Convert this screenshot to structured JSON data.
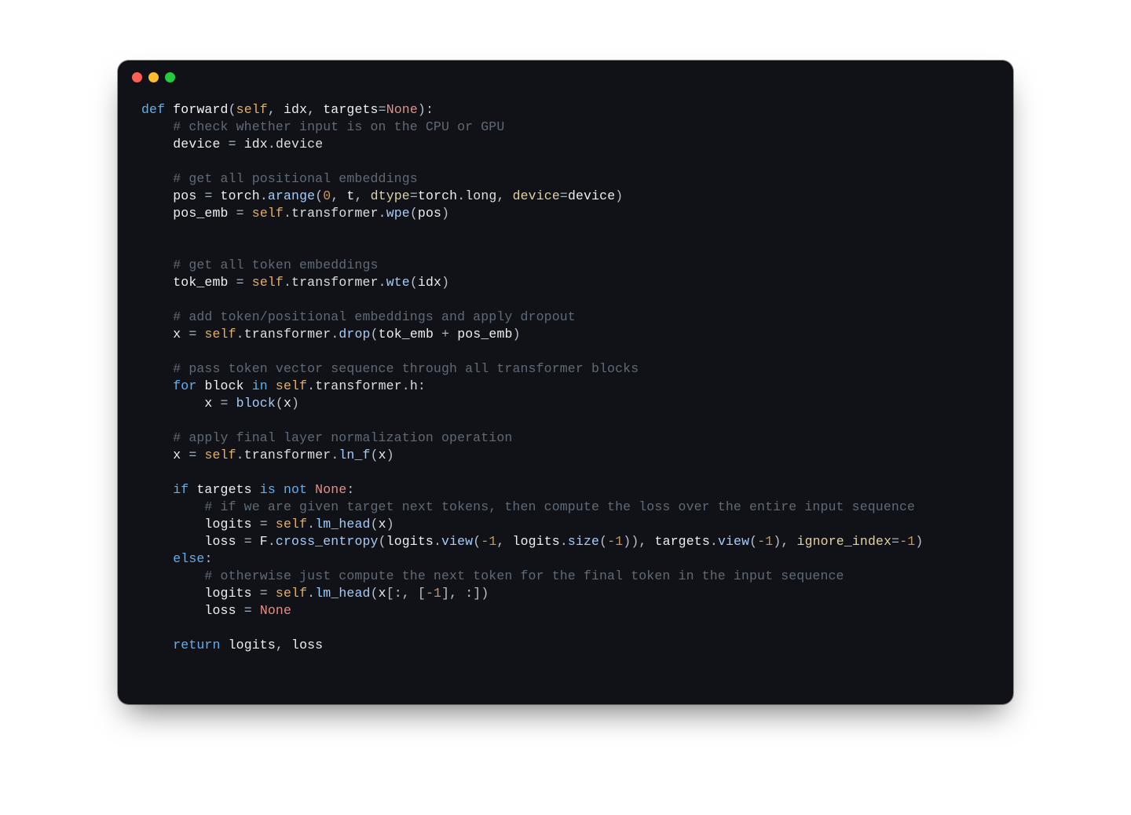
{
  "window": {
    "title": ""
  },
  "colors": {
    "editor_bg": "#111217",
    "dot_red": "#ff5f56",
    "dot_yellow": "#ffbd2e",
    "dot_green": "#27c93f"
  },
  "code": {
    "lines": [
      [
        {
          "t": "kw",
          "v": "def "
        },
        {
          "t": "fn",
          "v": "forward"
        },
        {
          "t": "punct",
          "v": "("
        },
        {
          "t": "self",
          "v": "self"
        },
        {
          "t": "punct",
          "v": ", "
        },
        {
          "t": "var",
          "v": "idx"
        },
        {
          "t": "punct",
          "v": ", "
        },
        {
          "t": "var",
          "v": "targets"
        },
        {
          "t": "op",
          "v": "="
        },
        {
          "t": "none",
          "v": "None"
        },
        {
          "t": "punct",
          "v": "):"
        }
      ],
      [
        {
          "t": "indent",
          "v": "    "
        },
        {
          "t": "comment",
          "v": "# check whether input is on the CPU or GPU"
        }
      ],
      [
        {
          "t": "indent",
          "v": "    "
        },
        {
          "t": "var",
          "v": "device "
        },
        {
          "t": "op",
          "v": "="
        },
        {
          "t": "var",
          "v": " idx"
        },
        {
          "t": "punct",
          "v": "."
        },
        {
          "t": "prop",
          "v": "device"
        }
      ],
      [],
      [
        {
          "t": "indent",
          "v": "    "
        },
        {
          "t": "comment",
          "v": "# get all positional embeddings"
        }
      ],
      [
        {
          "t": "indent",
          "v": "    "
        },
        {
          "t": "var",
          "v": "pos "
        },
        {
          "t": "op",
          "v": "="
        },
        {
          "t": "var",
          "v": " torch"
        },
        {
          "t": "punct",
          "v": "."
        },
        {
          "t": "method",
          "v": "arange"
        },
        {
          "t": "punct",
          "v": "("
        },
        {
          "t": "num",
          "v": "0"
        },
        {
          "t": "punct",
          "v": ", "
        },
        {
          "t": "var",
          "v": "t"
        },
        {
          "t": "punct",
          "v": ", "
        },
        {
          "t": "kwarg",
          "v": "dtype"
        },
        {
          "t": "op",
          "v": "="
        },
        {
          "t": "var",
          "v": "torch"
        },
        {
          "t": "punct",
          "v": "."
        },
        {
          "t": "prop",
          "v": "long"
        },
        {
          "t": "punct",
          "v": ", "
        },
        {
          "t": "kwarg",
          "v": "device"
        },
        {
          "t": "op",
          "v": "="
        },
        {
          "t": "var",
          "v": "device"
        },
        {
          "t": "punct",
          "v": ")"
        }
      ],
      [
        {
          "t": "indent",
          "v": "    "
        },
        {
          "t": "var",
          "v": "pos_emb "
        },
        {
          "t": "op",
          "v": "="
        },
        {
          "t": "var",
          "v": " "
        },
        {
          "t": "self",
          "v": "self"
        },
        {
          "t": "punct",
          "v": "."
        },
        {
          "t": "prop",
          "v": "transformer"
        },
        {
          "t": "punct",
          "v": "."
        },
        {
          "t": "method",
          "v": "wpe"
        },
        {
          "t": "punct",
          "v": "("
        },
        {
          "t": "var",
          "v": "pos"
        },
        {
          "t": "punct",
          "v": ")"
        }
      ],
      [],
      [],
      [
        {
          "t": "indent",
          "v": "    "
        },
        {
          "t": "comment",
          "v": "# get all token embeddings"
        }
      ],
      [
        {
          "t": "indent",
          "v": "    "
        },
        {
          "t": "var",
          "v": "tok_emb "
        },
        {
          "t": "op",
          "v": "="
        },
        {
          "t": "var",
          "v": " "
        },
        {
          "t": "self",
          "v": "self"
        },
        {
          "t": "punct",
          "v": "."
        },
        {
          "t": "prop",
          "v": "transformer"
        },
        {
          "t": "punct",
          "v": "."
        },
        {
          "t": "method",
          "v": "wte"
        },
        {
          "t": "punct",
          "v": "("
        },
        {
          "t": "var",
          "v": "idx"
        },
        {
          "t": "punct",
          "v": ")"
        }
      ],
      [],
      [
        {
          "t": "indent",
          "v": "    "
        },
        {
          "t": "comment",
          "v": "# add token/positional embeddings and apply dropout"
        }
      ],
      [
        {
          "t": "indent",
          "v": "    "
        },
        {
          "t": "var",
          "v": "x "
        },
        {
          "t": "op",
          "v": "="
        },
        {
          "t": "var",
          "v": " "
        },
        {
          "t": "self",
          "v": "self"
        },
        {
          "t": "punct",
          "v": "."
        },
        {
          "t": "prop",
          "v": "transformer"
        },
        {
          "t": "punct",
          "v": "."
        },
        {
          "t": "method",
          "v": "drop"
        },
        {
          "t": "punct",
          "v": "("
        },
        {
          "t": "var",
          "v": "tok_emb "
        },
        {
          "t": "op",
          "v": "+"
        },
        {
          "t": "var",
          "v": " pos_emb"
        },
        {
          "t": "punct",
          "v": ")"
        }
      ],
      [],
      [
        {
          "t": "indent",
          "v": "    "
        },
        {
          "t": "comment",
          "v": "# pass token vector sequence through all transformer blocks"
        }
      ],
      [
        {
          "t": "indent",
          "v": "    "
        },
        {
          "t": "kw",
          "v": "for "
        },
        {
          "t": "var",
          "v": "block "
        },
        {
          "t": "kw",
          "v": "in "
        },
        {
          "t": "self",
          "v": "self"
        },
        {
          "t": "punct",
          "v": "."
        },
        {
          "t": "prop",
          "v": "transformer"
        },
        {
          "t": "punct",
          "v": "."
        },
        {
          "t": "prop",
          "v": "h"
        },
        {
          "t": "punct",
          "v": ":"
        }
      ],
      [
        {
          "t": "indent",
          "v": "        "
        },
        {
          "t": "var",
          "v": "x "
        },
        {
          "t": "op",
          "v": "="
        },
        {
          "t": "var",
          "v": " "
        },
        {
          "t": "method",
          "v": "block"
        },
        {
          "t": "punct",
          "v": "("
        },
        {
          "t": "var",
          "v": "x"
        },
        {
          "t": "punct",
          "v": ")"
        }
      ],
      [],
      [
        {
          "t": "indent",
          "v": "    "
        },
        {
          "t": "comment",
          "v": "# apply final layer normalization operation"
        }
      ],
      [
        {
          "t": "indent",
          "v": "    "
        },
        {
          "t": "var",
          "v": "x "
        },
        {
          "t": "op",
          "v": "="
        },
        {
          "t": "var",
          "v": " "
        },
        {
          "t": "self",
          "v": "self"
        },
        {
          "t": "punct",
          "v": "."
        },
        {
          "t": "prop",
          "v": "transformer"
        },
        {
          "t": "punct",
          "v": "."
        },
        {
          "t": "method",
          "v": "ln_f"
        },
        {
          "t": "punct",
          "v": "("
        },
        {
          "t": "var",
          "v": "x"
        },
        {
          "t": "punct",
          "v": ")"
        }
      ],
      [],
      [
        {
          "t": "indent",
          "v": "    "
        },
        {
          "t": "kw",
          "v": "if "
        },
        {
          "t": "var",
          "v": "targets "
        },
        {
          "t": "kw",
          "v": "is not "
        },
        {
          "t": "none",
          "v": "None"
        },
        {
          "t": "punct",
          "v": ":"
        }
      ],
      [
        {
          "t": "indent",
          "v": "        "
        },
        {
          "t": "comment",
          "v": "# if we are given target next tokens, then compute the loss over the entire input sequence"
        }
      ],
      [
        {
          "t": "indent",
          "v": "        "
        },
        {
          "t": "var",
          "v": "logits "
        },
        {
          "t": "op",
          "v": "="
        },
        {
          "t": "var",
          "v": " "
        },
        {
          "t": "self",
          "v": "self"
        },
        {
          "t": "punct",
          "v": "."
        },
        {
          "t": "method",
          "v": "lm_head"
        },
        {
          "t": "punct",
          "v": "("
        },
        {
          "t": "var",
          "v": "x"
        },
        {
          "t": "punct",
          "v": ")"
        }
      ],
      [
        {
          "t": "indent",
          "v": "        "
        },
        {
          "t": "var",
          "v": "loss "
        },
        {
          "t": "op",
          "v": "="
        },
        {
          "t": "var",
          "v": " F"
        },
        {
          "t": "punct",
          "v": "."
        },
        {
          "t": "method",
          "v": "cross_entropy"
        },
        {
          "t": "punct",
          "v": "("
        },
        {
          "t": "var",
          "v": "logits"
        },
        {
          "t": "punct",
          "v": "."
        },
        {
          "t": "method",
          "v": "view"
        },
        {
          "t": "punct",
          "v": "("
        },
        {
          "t": "num",
          "v": "-1"
        },
        {
          "t": "punct",
          "v": ", "
        },
        {
          "t": "var",
          "v": "logits"
        },
        {
          "t": "punct",
          "v": "."
        },
        {
          "t": "method",
          "v": "size"
        },
        {
          "t": "punct",
          "v": "("
        },
        {
          "t": "num",
          "v": "-1"
        },
        {
          "t": "punct",
          "v": "))"
        },
        {
          "t": "punct",
          "v": ", "
        },
        {
          "t": "var",
          "v": "targets"
        },
        {
          "t": "punct",
          "v": "."
        },
        {
          "t": "method",
          "v": "view"
        },
        {
          "t": "punct",
          "v": "("
        },
        {
          "t": "num",
          "v": "-1"
        },
        {
          "t": "punct",
          "v": ")"
        },
        {
          "t": "punct",
          "v": ", "
        },
        {
          "t": "kwarg",
          "v": "ignore_index"
        },
        {
          "t": "op",
          "v": "="
        },
        {
          "t": "num",
          "v": "-1"
        },
        {
          "t": "punct",
          "v": ")"
        }
      ],
      [
        {
          "t": "indent",
          "v": "    "
        },
        {
          "t": "kw",
          "v": "else"
        },
        {
          "t": "punct",
          "v": ":"
        }
      ],
      [
        {
          "t": "indent",
          "v": "        "
        },
        {
          "t": "comment",
          "v": "# otherwise just compute the next token for the final token in the input sequence"
        }
      ],
      [
        {
          "t": "indent",
          "v": "        "
        },
        {
          "t": "var",
          "v": "logits "
        },
        {
          "t": "op",
          "v": "="
        },
        {
          "t": "var",
          "v": " "
        },
        {
          "t": "self",
          "v": "self"
        },
        {
          "t": "punct",
          "v": "."
        },
        {
          "t": "method",
          "v": "lm_head"
        },
        {
          "t": "punct",
          "v": "("
        },
        {
          "t": "var",
          "v": "x"
        },
        {
          "t": "punct",
          "v": "[:, ["
        },
        {
          "t": "num",
          "v": "-1"
        },
        {
          "t": "punct",
          "v": "], :])"
        }
      ],
      [
        {
          "t": "indent",
          "v": "        "
        },
        {
          "t": "var",
          "v": "loss "
        },
        {
          "t": "op",
          "v": "="
        },
        {
          "t": "var",
          "v": " "
        },
        {
          "t": "none",
          "v": "None"
        }
      ],
      [],
      [
        {
          "t": "indent",
          "v": "    "
        },
        {
          "t": "return",
          "v": "return "
        },
        {
          "t": "var",
          "v": "logits"
        },
        {
          "t": "punct",
          "v": ", "
        },
        {
          "t": "var",
          "v": "loss"
        }
      ]
    ]
  }
}
